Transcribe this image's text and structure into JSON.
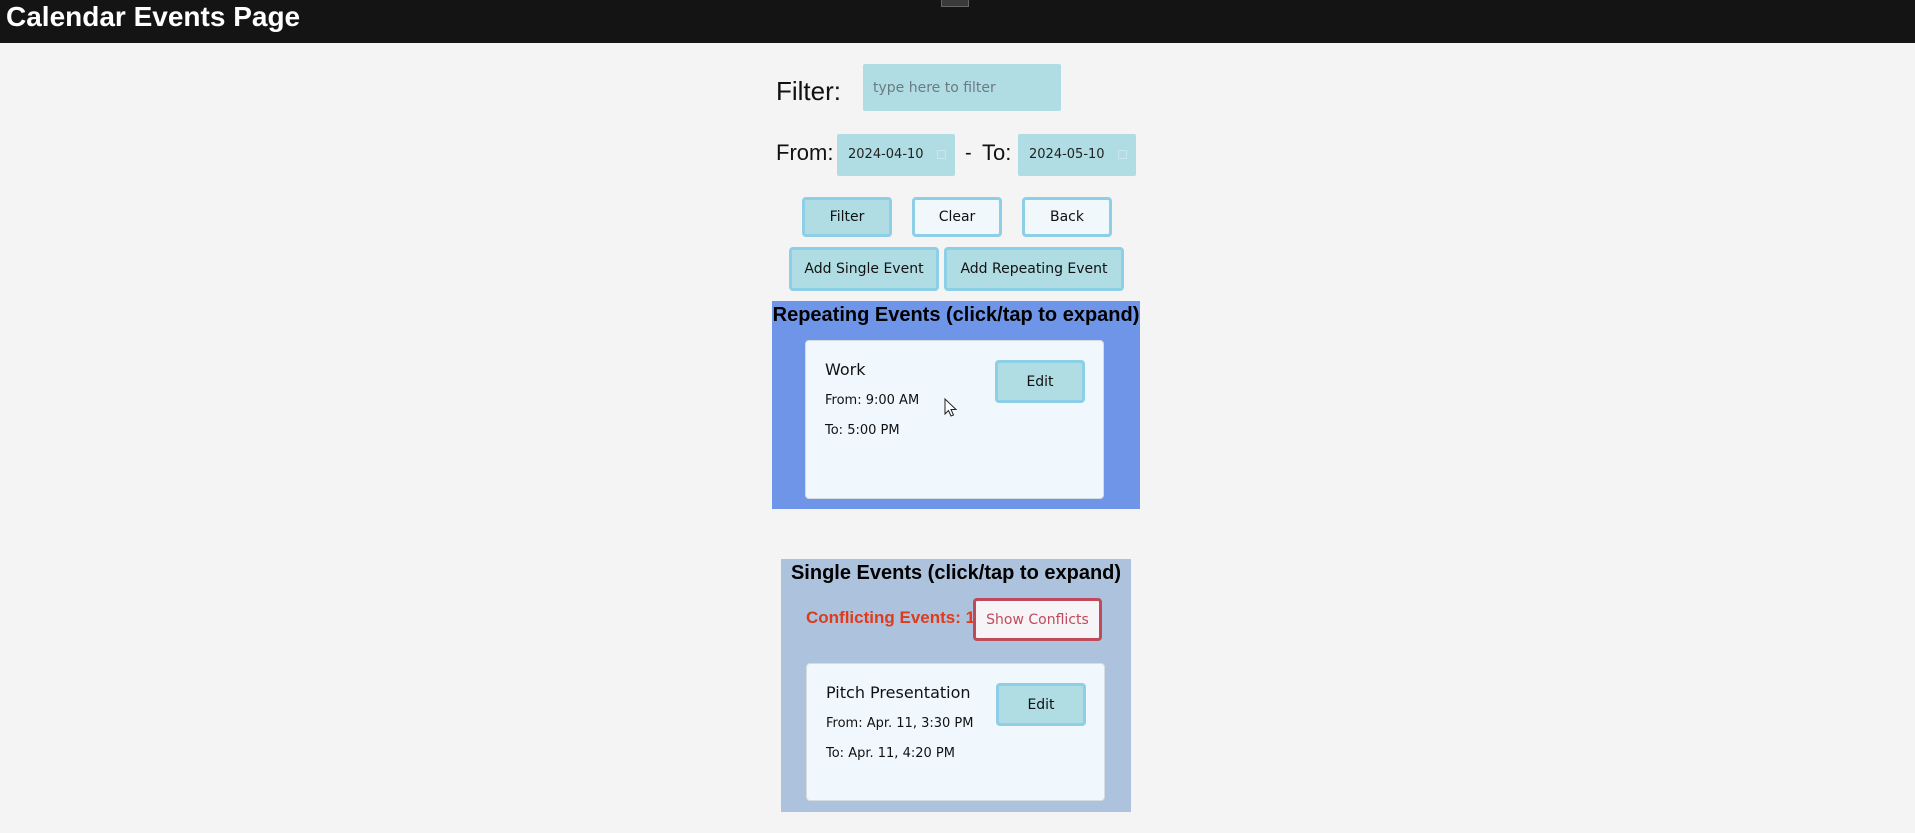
{
  "header": {
    "title": "Calendar Events Page"
  },
  "filters": {
    "filter_label": "Filter:",
    "filter_placeholder": "type here to filter",
    "filter_value": "",
    "from_label": "From:",
    "from_value": "2024-04-10",
    "separator": "-",
    "to_label": "To:",
    "to_value": "2024-05-10"
  },
  "buttons": {
    "filter": "Filter",
    "clear": "Clear",
    "back": "Back",
    "add_single": "Add Single Event",
    "add_repeating": "Add Repeating Event"
  },
  "repeating": {
    "heading": "Repeating Events (click/tap to expand)",
    "events": [
      {
        "name": "Work",
        "from": "From: 9:00 AM",
        "to": "To: 5:00 PM",
        "edit_label": "Edit"
      }
    ]
  },
  "single": {
    "heading": "Single Events (click/tap to expand)",
    "conflicts_text": "Conflicting Events: 1",
    "show_conflicts_label": "Show Conflicts",
    "events": [
      {
        "name": "Pitch Presentation",
        "from": "From: Apr. 11, 3:30 PM",
        "to": "To: Apr. 11, 4:20 PM",
        "edit_label": "Edit"
      }
    ]
  },
  "colors": {
    "topbar": "#141414",
    "page_bg": "#f4f4f4",
    "input_bg": "#b0dde4",
    "button_border": "#8ccfe6",
    "repeating_panel": "#6e95e8",
    "single_panel": "#adc2dc",
    "card_bg": "#f0f8fd",
    "conflict_text": "#e03a1c",
    "conflict_button": "#c04a5c"
  }
}
